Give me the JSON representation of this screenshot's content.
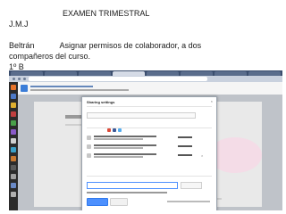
{
  "document": {
    "heading": "EXAMEN TRIMESTRAL",
    "initials": "J.M.J",
    "name": "Beltrán",
    "task_line1": "Asignar permisos de colaborador,  a dos",
    "task_line2": "compañeros del curso.",
    "group": "1º B"
  },
  "screenshot": {
    "dialog_title": "Sharing settings",
    "dialog_close": "×",
    "colors": {
      "browser_tabbar": "#3b4e6e",
      "dock": "#2b2b2b",
      "dialog_border": "#9aa3ad",
      "share_button": "#4d90fe",
      "pink_graphic": "#f6d8e6"
    }
  }
}
